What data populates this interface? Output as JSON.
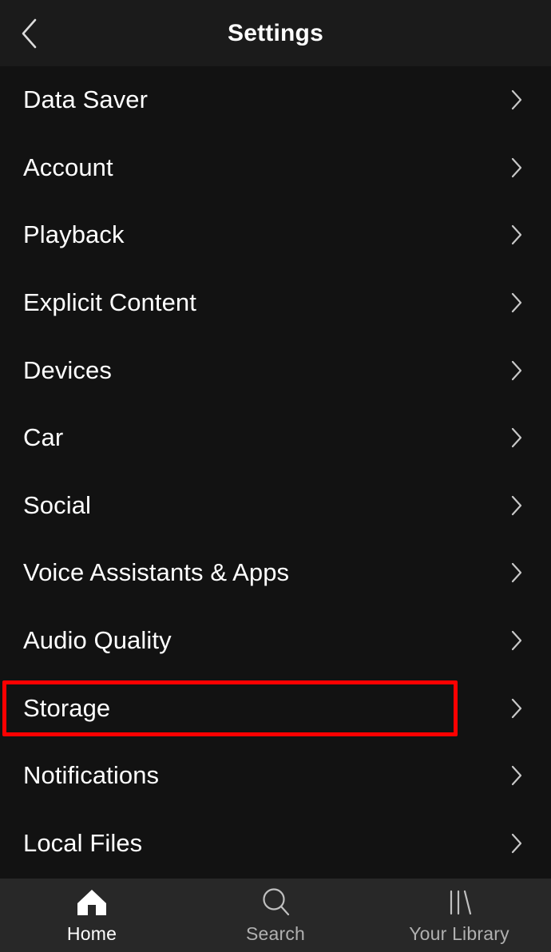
{
  "header": {
    "title": "Settings",
    "back_icon": "chevron-left-icon"
  },
  "settings": {
    "items": [
      {
        "label": "Data Saver",
        "chevron": "chevron-right-icon",
        "highlighted": false
      },
      {
        "label": "Account",
        "chevron": "chevron-right-icon",
        "highlighted": false
      },
      {
        "label": "Playback",
        "chevron": "chevron-right-icon",
        "highlighted": false
      },
      {
        "label": "Explicit Content",
        "chevron": "chevron-right-icon",
        "highlighted": false
      },
      {
        "label": "Devices",
        "chevron": "chevron-right-icon",
        "highlighted": false
      },
      {
        "label": "Car",
        "chevron": "chevron-right-icon",
        "highlighted": false
      },
      {
        "label": "Social",
        "chevron": "chevron-right-icon",
        "highlighted": false
      },
      {
        "label": "Voice Assistants & Apps",
        "chevron": "chevron-right-icon",
        "highlighted": false
      },
      {
        "label": "Audio Quality",
        "chevron": "chevron-right-icon",
        "highlighted": false
      },
      {
        "label": "Storage",
        "chevron": "chevron-right-icon",
        "highlighted": true
      },
      {
        "label": "Notifications",
        "chevron": "chevron-right-icon",
        "highlighted": false
      },
      {
        "label": "Local Files",
        "chevron": "chevron-right-icon",
        "highlighted": false
      }
    ]
  },
  "highlight": {
    "target_label": "Storage",
    "color": "#fe0000"
  },
  "bottom_nav": {
    "items": [
      {
        "label": "Home",
        "icon": "home-icon",
        "active": true
      },
      {
        "label": "Search",
        "icon": "search-icon",
        "active": false
      },
      {
        "label": "Your Library",
        "icon": "library-icon",
        "active": false
      }
    ]
  },
  "colors": {
    "header_background": "#1b1b1b",
    "list_background": "#121212",
    "nav_background": "#282828",
    "text_primary": "#ffffff",
    "text_secondary": "#b0b0b0",
    "highlight": "#fe0000"
  }
}
